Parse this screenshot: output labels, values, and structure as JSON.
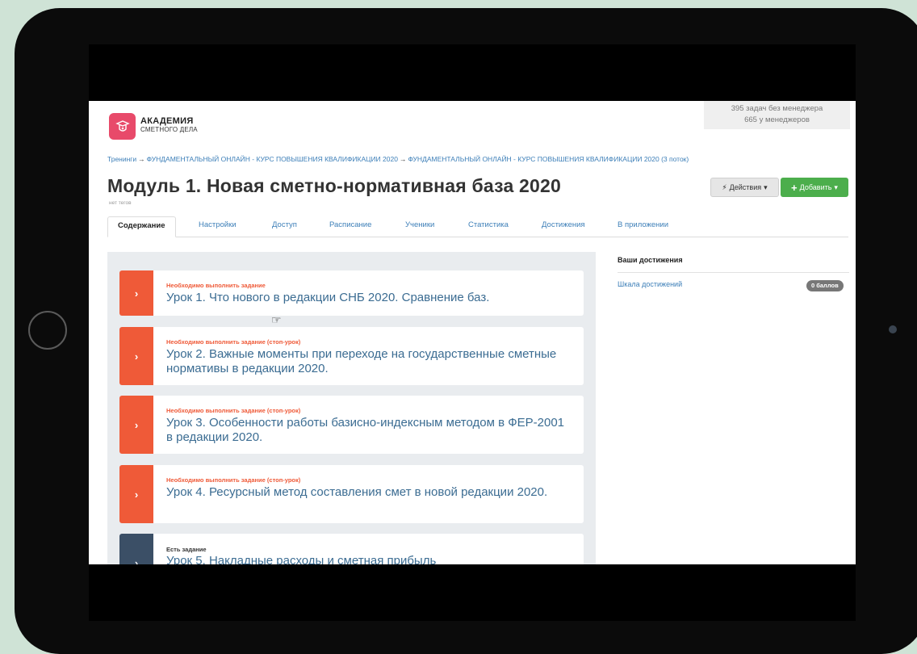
{
  "logo": {
    "line1": "АКАДЕМИЯ",
    "line2": "СМЕТНОГО ДЕЛА"
  },
  "manager_stats": {
    "without_manager": "395 задач без менеджера",
    "with_manager": "665 у менеджеров"
  },
  "breadcrumb": [
    "Тренинги",
    "ФУНДАМЕНТАЛЬНЫЙ ОНЛАЙН - КУРС ПОВЫШЕНИЯ КВАЛИФИКАЦИИ 2020",
    "ФУНДАМЕНТАЛЬНЫЙ ОНЛАЙН - КУРС ПОВЫШЕНИЯ КВАЛИФИКАЦИИ 2020 (3 поток)"
  ],
  "breadcrumb_separator": "→",
  "page": {
    "title": "Модуль 1. Новая сметно-нормативная база 2020",
    "subtitle": "нет тегов"
  },
  "actions": {
    "actions_label": "Действия",
    "add_label": "Добавить"
  },
  "tabs": [
    {
      "label": "Содержание",
      "active": true
    },
    {
      "label": "Настройки"
    },
    {
      "label": "Доступ"
    },
    {
      "label": "Расписание"
    },
    {
      "label": "Ученики"
    },
    {
      "label": "Статистика"
    },
    {
      "label": "Достижения"
    },
    {
      "label": "В приложении"
    }
  ],
  "lessons": [
    {
      "status": "Необходимо выполнить задание",
      "title": "Урок 1. Что нового в редакции СНБ 2020. Сравнение баз."
    },
    {
      "status": "Необходимо выполнить задание (стоп-урок)",
      "title": "Урок 2. Важные моменты при переходе на государственные сметные нормативы в редакции 2020."
    },
    {
      "status": "Необходимо выполнить задание (стоп-урок)",
      "title": "Урок 3. Особенности работы базисно-индексным методом в ФЕР-2001 в редакции 2020."
    },
    {
      "status": "Необходимо выполнить задание (стоп-урок)",
      "title": "Урок 4. Ресурсный метод составления смет в новой редакции 2020."
    },
    {
      "status": "Есть задание",
      "title": "Урок 5. Накладные расходы и сметная прибыль"
    }
  ],
  "achievements": {
    "title": "Ваши достижения",
    "scale_link": "Шкала достижений",
    "points": "0 баллов"
  },
  "colors": {
    "accent_orange": "#ef5a38",
    "link_blue": "#3d7fb8",
    "add_green": "#4cae4c",
    "logo_pink": "#e84a6a",
    "dark_arrow": "#3b4f66"
  },
  "icons": {
    "actions": "bolt-icon",
    "add": "plus-icon",
    "lesson": "chevron-right-icon",
    "cursor": "hand-pointer-icon"
  }
}
